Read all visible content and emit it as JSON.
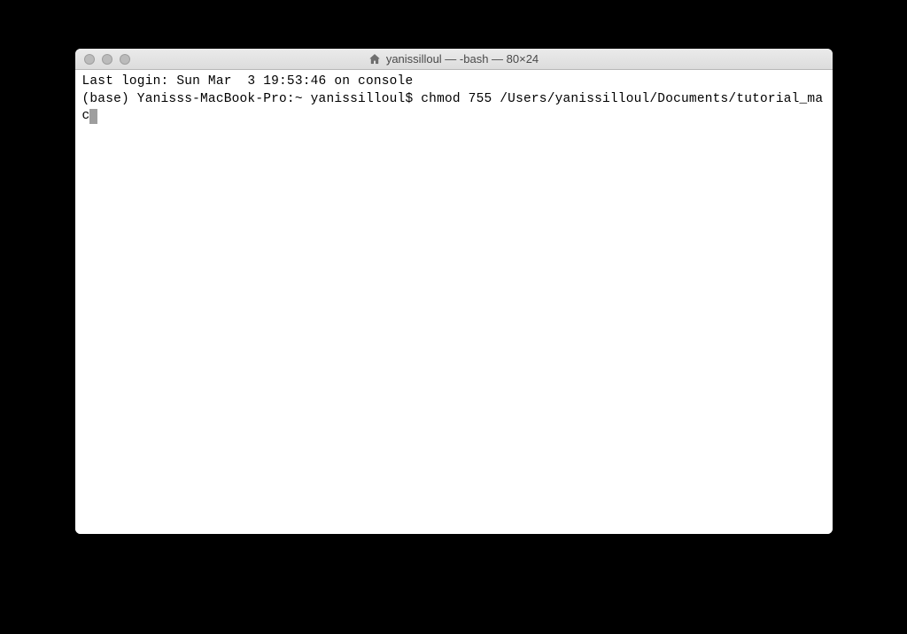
{
  "window": {
    "title": "yanissilloul — -bash — 80×24"
  },
  "terminal": {
    "line1": "Last login: Sun Mar  3 19:53:46 on console",
    "line2_prompt": "(base) Yanisss-MacBook-Pro:~ yanissilloul$ ",
    "line2_command": "chmod 755 /Users/yanissilloul/Documents/tutorial_mac"
  }
}
